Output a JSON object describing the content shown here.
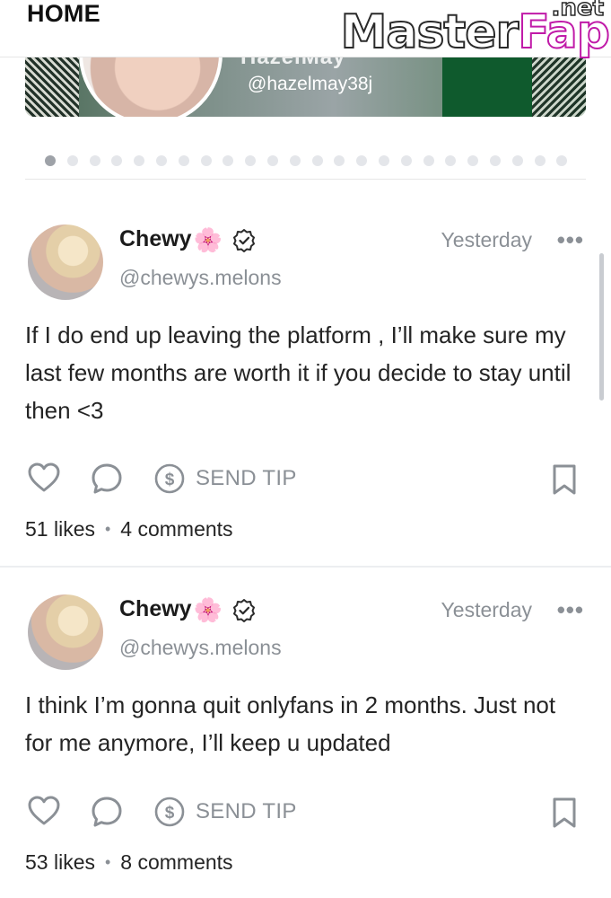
{
  "header": {
    "title": "HOME"
  },
  "watermark": {
    "text_master": "Master",
    "text_fap": "Fap",
    "text_net": ".net"
  },
  "suggestion": {
    "name_partial": "HazelMay",
    "handle": "@hazelmay38j",
    "pager": {
      "total": 24,
      "active": 0
    }
  },
  "posts": [
    {
      "author": "Chewy",
      "emoji": "🌸",
      "username": "@chewys.melons",
      "time": "Yesterday",
      "text": "If I do end up leaving the platform , I’ll make sure my last few months are worth it if you decide to stay until then <3",
      "send_tip_label": "SEND TIP",
      "likes": "51 likes",
      "comments": "4 comments"
    },
    {
      "author": "Chewy",
      "emoji": "🌸",
      "username": "@chewys.melons",
      "time": "Yesterday",
      "text": "I think I’m gonna quit onlyfans in 2 months. Just not for me anymore, I’ll keep u updated",
      "send_tip_label": "SEND TIP",
      "likes": "53 likes",
      "comments": "8 comments"
    }
  ],
  "icons": {
    "like": "heart-icon",
    "comment": "comment-bubble-icon",
    "tip": "dollar-circle-icon",
    "bookmark": "bookmark-icon",
    "more": "more-horizontal-icon",
    "verified": "verified-badge-icon"
  },
  "colors": {
    "muted_text": "#8b9096",
    "body_text": "#242424",
    "icon_gray": "#8b9096",
    "watermark_magenta": "#c01aa8"
  }
}
